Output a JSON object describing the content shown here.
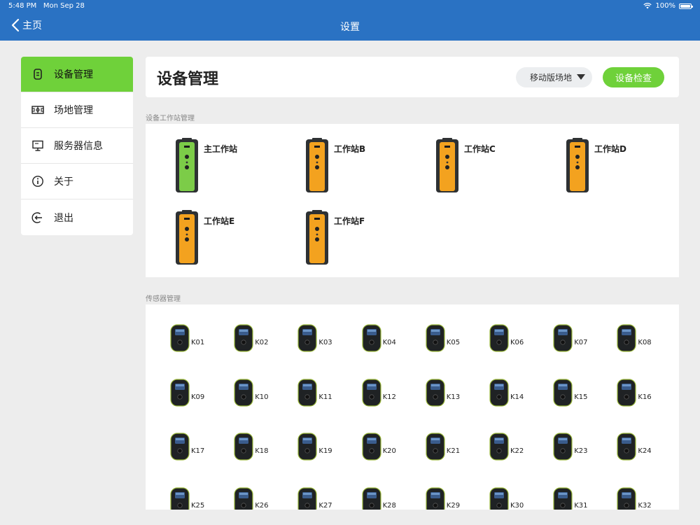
{
  "status_bar": {
    "time": "5:48 PM",
    "date": "Mon Sep 28",
    "battery": "100%"
  },
  "nav": {
    "back_label": "主页",
    "title": "设置"
  },
  "sidebar": {
    "items": [
      {
        "label": "设备管理",
        "icon": "device-icon",
        "active": true
      },
      {
        "label": "场地管理",
        "icon": "field-icon",
        "active": false
      },
      {
        "label": "服务器信息",
        "icon": "server-icon",
        "active": false
      },
      {
        "label": "关于",
        "icon": "info-icon",
        "active": false
      },
      {
        "label": "退出",
        "icon": "logout-icon",
        "active": false
      }
    ]
  },
  "header": {
    "title": "设备管理",
    "venue_select": "移动版场地",
    "check_button": "设备检查"
  },
  "stations_section": {
    "label": "设备工作站管理",
    "items": [
      {
        "name": "主工作站",
        "color": "#7ccc48"
      },
      {
        "name": "工作站B",
        "color": "#f3a21f"
      },
      {
        "name": "工作站C",
        "color": "#f3a21f"
      },
      {
        "name": "工作站D",
        "color": "#f3a21f"
      },
      {
        "name": "工作站E",
        "color": "#f3a21f"
      },
      {
        "name": "工作站F",
        "color": "#f3a21f"
      }
    ]
  },
  "sensors_section": {
    "label": "传感器管理",
    "items": [
      "K01",
      "K02",
      "K03",
      "K04",
      "K05",
      "K06",
      "K07",
      "K08",
      "K09",
      "K10",
      "K11",
      "K12",
      "K13",
      "K14",
      "K15",
      "K16",
      "K17",
      "K18",
      "K19",
      "K20",
      "K21",
      "K22",
      "K23",
      "K24",
      "K25",
      "K26",
      "K27",
      "K28",
      "K29",
      "K30",
      "K31",
      "K32"
    ]
  },
  "colors": {
    "nav_blue": "#2a72c3",
    "accent_green": "#6fd13a",
    "station_orange": "#f3a21f",
    "station_green": "#7ccc48"
  }
}
